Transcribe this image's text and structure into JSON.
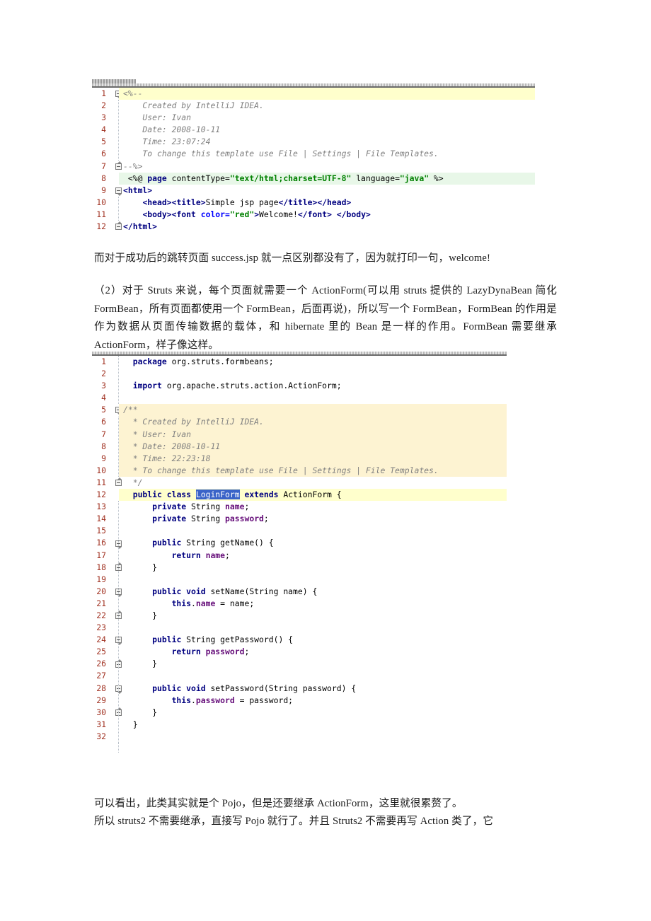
{
  "document": {
    "title": "Struts vs Struts2 FormBean notes"
  },
  "colors": {
    "keyword": "#000080",
    "string": "#008000",
    "comment": "#808080",
    "field": "#660e7a",
    "attribute": "#0000ff",
    "line_number": "#a03020",
    "selection": "#3a63c8",
    "highlight_line": "#ffffcc",
    "javadoc_bg": "#fdf3d2",
    "directive_bg": "#e8f7e8"
  },
  "code_block_jsp": {
    "name": "jsp-editor",
    "line_numbers": [
      "1",
      "2",
      "3",
      "4",
      "5",
      "6",
      "7",
      "8",
      "9",
      "10",
      "11",
      "12"
    ],
    "lines": [
      {
        "n": "1",
        "highlight": "yellow",
        "fold": "down",
        "indent_guide": false,
        "tokens": [
          {
            "t": "<%--",
            "c": "cmt"
          }
        ]
      },
      {
        "n": "2",
        "highlight": "none",
        "fold": "",
        "indent_guide": true,
        "tokens": [
          {
            "t": "    Created by IntelliJ IDEA.",
            "c": "cmt"
          }
        ]
      },
      {
        "n": "3",
        "highlight": "none",
        "fold": "",
        "indent_guide": true,
        "tokens": [
          {
            "t": "    User: Ivan",
            "c": "cmt"
          }
        ]
      },
      {
        "n": "4",
        "highlight": "none",
        "fold": "",
        "indent_guide": true,
        "tokens": [
          {
            "t": "    Date: 2008-10-11",
            "c": "cmt"
          }
        ]
      },
      {
        "n": "5",
        "highlight": "none",
        "fold": "",
        "indent_guide": true,
        "tokens": [
          {
            "t": "    Time: 23:07:24",
            "c": "cmt"
          }
        ]
      },
      {
        "n": "6",
        "highlight": "none",
        "fold": "",
        "indent_guide": true,
        "tokens": [
          {
            "t": "    To change this template use File | Settings | File Templates.",
            "c": "cmt"
          }
        ]
      },
      {
        "n": "7",
        "highlight": "none",
        "fold": "up",
        "indent_guide": false,
        "tokens": [
          {
            "t": "--%>",
            "c": "cmt"
          }
        ]
      },
      {
        "n": "8",
        "highlight": "green",
        "fold": "",
        "indent_guide": false,
        "tokens": [
          {
            "t": " <%@ ",
            "c": "plain"
          },
          {
            "t": "page",
            "c": "kw"
          },
          {
            "t": " contentType=",
            "c": "plain"
          },
          {
            "t": "\"text/html;charset=UTF-8\"",
            "c": "str"
          },
          {
            "t": " language=",
            "c": "plain"
          },
          {
            "t": "\"java\"",
            "c": "str"
          },
          {
            "t": " %>",
            "c": "plain"
          }
        ]
      },
      {
        "n": "9",
        "highlight": "none",
        "fold": "down",
        "indent_guide": false,
        "tokens": [
          {
            "t": "<html>",
            "c": "tag"
          }
        ]
      },
      {
        "n": "10",
        "highlight": "none",
        "fold": "",
        "indent_guide": true,
        "tokens": [
          {
            "t": "    ",
            "c": "plain"
          },
          {
            "t": "<head><title>",
            "c": "tag"
          },
          {
            "t": "Simple jsp page",
            "c": "plain"
          },
          {
            "t": "</title></head>",
            "c": "tag"
          }
        ]
      },
      {
        "n": "11",
        "highlight": "none",
        "fold": "",
        "indent_guide": true,
        "tokens": [
          {
            "t": "    ",
            "c": "plain"
          },
          {
            "t": "<body><font ",
            "c": "tag"
          },
          {
            "t": "color=",
            "c": "attr"
          },
          {
            "t": "\"red\"",
            "c": "str"
          },
          {
            "t": ">",
            "c": "tag"
          },
          {
            "t": "Welcome!",
            "c": "plain"
          },
          {
            "t": "</font>",
            "c": "tag"
          },
          {
            "t": " ",
            "c": "plain"
          },
          {
            "t": "</body>",
            "c": "tag"
          }
        ]
      },
      {
        "n": "12",
        "highlight": "none",
        "fold": "up",
        "indent_guide": false,
        "tokens": [
          {
            "t": "</html>",
            "c": "tag"
          }
        ]
      }
    ]
  },
  "paragraph_1": "而对于成功后的跳转页面 success.jsp 就一点区别都没有了，因为就打印一句，welcome!",
  "paragraph_2": "（2）对于 Struts 来说，每个页面就需要一个 ActionForm(可以用 struts 提供的 LazyDynaBean 简化 FormBean，所有页面都使用一个 FormBean，后面再说)，所以写一个 FormBean，FormBean 的作用是作为数据从页面传输数据的载体，和 hibernate 里的 Bean 是一样的作用。FormBean 需要继承 ActionForm，样子像这样。",
  "code_block_java": {
    "name": "java-editor",
    "line_numbers": [
      "1",
      "2",
      "3",
      "4",
      "5",
      "6",
      "7",
      "8",
      "9",
      "10",
      "11",
      "12",
      "13",
      "14",
      "15",
      "16",
      "17",
      "18",
      "19",
      "20",
      "21",
      "22",
      "23",
      "24",
      "25",
      "26",
      "27",
      "28",
      "29",
      "30",
      "31",
      "32"
    ],
    "lines": [
      {
        "n": "1",
        "highlight": "none",
        "fold": "",
        "indent_guide": true,
        "tokens": [
          {
            "t": "  ",
            "c": "plain"
          },
          {
            "t": "package",
            "c": "kw"
          },
          {
            "t": " org.struts.formbeans;",
            "c": "plain"
          }
        ]
      },
      {
        "n": "2",
        "highlight": "none",
        "fold": "",
        "indent_guide": true,
        "tokens": [
          {
            "t": "",
            "c": "plain"
          }
        ]
      },
      {
        "n": "3",
        "highlight": "none",
        "fold": "",
        "indent_guide": true,
        "tokens": [
          {
            "t": "  ",
            "c": "plain"
          },
          {
            "t": "import",
            "c": "kw"
          },
          {
            "t": " org.apache.struts.action.ActionForm;",
            "c": "plain"
          }
        ]
      },
      {
        "n": "4",
        "highlight": "none",
        "fold": "",
        "indent_guide": true,
        "tokens": [
          {
            "t": "",
            "c": "plain"
          }
        ]
      },
      {
        "n": "5",
        "highlight": "cream",
        "fold": "down",
        "indent_guide": false,
        "tokens": [
          {
            "t": "/**",
            "c": "cmt"
          }
        ]
      },
      {
        "n": "6",
        "highlight": "cream",
        "fold": "",
        "indent_guide": true,
        "tokens": [
          {
            "t": "  * Created by IntelliJ IDEA.",
            "c": "cmt"
          }
        ]
      },
      {
        "n": "7",
        "highlight": "cream",
        "fold": "",
        "indent_guide": true,
        "tokens": [
          {
            "t": "  * User: Ivan",
            "c": "cmt"
          }
        ]
      },
      {
        "n": "8",
        "highlight": "cream",
        "fold": "",
        "indent_guide": true,
        "tokens": [
          {
            "t": "  * Date: 2008-10-11",
            "c": "cmt"
          }
        ]
      },
      {
        "n": "9",
        "highlight": "cream",
        "fold": "",
        "indent_guide": true,
        "tokens": [
          {
            "t": "  * Time: 22:23:18",
            "c": "cmt"
          }
        ]
      },
      {
        "n": "10",
        "highlight": "cream",
        "fold": "",
        "indent_guide": true,
        "tokens": [
          {
            "t": "  * To change this template use File | Settings | File Templates.",
            "c": "cmt"
          }
        ]
      },
      {
        "n": "11",
        "highlight": "none",
        "fold": "up",
        "indent_guide": false,
        "tokens": [
          {
            "t": "  */",
            "c": "cmt"
          }
        ]
      },
      {
        "n": "12",
        "highlight": "selline",
        "fold": "",
        "indent_guide": false,
        "tokens": [
          {
            "t": "  ",
            "c": "plain"
          },
          {
            "t": "public class",
            "c": "kw"
          },
          {
            "t": " ",
            "c": "plain"
          },
          {
            "t": "LoginForm",
            "c": "sel"
          },
          {
            "t": " ",
            "c": "plain"
          },
          {
            "t": "extends",
            "c": "kw"
          },
          {
            "t": " ActionForm {",
            "c": "plain"
          }
        ]
      },
      {
        "n": "13",
        "highlight": "none",
        "fold": "",
        "indent_guide": true,
        "tokens": [
          {
            "t": "      ",
            "c": "plain"
          },
          {
            "t": "private",
            "c": "kw"
          },
          {
            "t": " String ",
            "c": "plain"
          },
          {
            "t": "name",
            "c": "fld"
          },
          {
            "t": ";",
            "c": "plain"
          }
        ]
      },
      {
        "n": "14",
        "highlight": "none",
        "fold": "",
        "indent_guide": true,
        "tokens": [
          {
            "t": "      ",
            "c": "plain"
          },
          {
            "t": "private",
            "c": "kw"
          },
          {
            "t": " String ",
            "c": "plain"
          },
          {
            "t": "password",
            "c": "fld"
          },
          {
            "t": ";",
            "c": "plain"
          }
        ]
      },
      {
        "n": "15",
        "highlight": "none",
        "fold": "",
        "indent_guide": true,
        "tokens": [
          {
            "t": "",
            "c": "plain"
          }
        ]
      },
      {
        "n": "16",
        "highlight": "none",
        "fold": "down",
        "indent_guide": true,
        "tokens": [
          {
            "t": "      ",
            "c": "plain"
          },
          {
            "t": "public",
            "c": "kw"
          },
          {
            "t": " String getName() {",
            "c": "plain"
          }
        ]
      },
      {
        "n": "17",
        "highlight": "none",
        "fold": "",
        "indent_guide": true,
        "tokens": [
          {
            "t": "          ",
            "c": "plain"
          },
          {
            "t": "return",
            "c": "kw"
          },
          {
            "t": " ",
            "c": "plain"
          },
          {
            "t": "name",
            "c": "fld"
          },
          {
            "t": ";",
            "c": "plain"
          }
        ]
      },
      {
        "n": "18",
        "highlight": "none",
        "fold": "up",
        "indent_guide": true,
        "tokens": [
          {
            "t": "      }",
            "c": "plain"
          }
        ]
      },
      {
        "n": "19",
        "highlight": "none",
        "fold": "",
        "indent_guide": true,
        "tokens": [
          {
            "t": "",
            "c": "plain"
          }
        ]
      },
      {
        "n": "20",
        "highlight": "none",
        "fold": "down",
        "indent_guide": true,
        "tokens": [
          {
            "t": "      ",
            "c": "plain"
          },
          {
            "t": "public void",
            "c": "kw"
          },
          {
            "t": " setName(String name) {",
            "c": "plain"
          }
        ]
      },
      {
        "n": "21",
        "highlight": "none",
        "fold": "",
        "indent_guide": true,
        "tokens": [
          {
            "t": "          ",
            "c": "plain"
          },
          {
            "t": "this",
            "c": "kw"
          },
          {
            "t": ".",
            "c": "plain"
          },
          {
            "t": "name",
            "c": "fld"
          },
          {
            "t": " = name;",
            "c": "plain"
          }
        ]
      },
      {
        "n": "22",
        "highlight": "none",
        "fold": "up",
        "indent_guide": true,
        "tokens": [
          {
            "t": "      }",
            "c": "plain"
          }
        ]
      },
      {
        "n": "23",
        "highlight": "none",
        "fold": "",
        "indent_guide": true,
        "tokens": [
          {
            "t": "",
            "c": "plain"
          }
        ]
      },
      {
        "n": "24",
        "highlight": "none",
        "fold": "down",
        "indent_guide": true,
        "tokens": [
          {
            "t": "      ",
            "c": "plain"
          },
          {
            "t": "public",
            "c": "kw"
          },
          {
            "t": " String getPassword() {",
            "c": "plain"
          }
        ]
      },
      {
        "n": "25",
        "highlight": "none",
        "fold": "",
        "indent_guide": true,
        "tokens": [
          {
            "t": "          ",
            "c": "plain"
          },
          {
            "t": "return",
            "c": "kw"
          },
          {
            "t": " ",
            "c": "plain"
          },
          {
            "t": "password",
            "c": "fld"
          },
          {
            "t": ";",
            "c": "plain"
          }
        ]
      },
      {
        "n": "26",
        "highlight": "none",
        "fold": "up",
        "indent_guide": true,
        "tokens": [
          {
            "t": "      }",
            "c": "plain"
          }
        ]
      },
      {
        "n": "27",
        "highlight": "none",
        "fold": "",
        "indent_guide": true,
        "tokens": [
          {
            "t": "",
            "c": "plain"
          }
        ]
      },
      {
        "n": "28",
        "highlight": "none",
        "fold": "down",
        "indent_guide": true,
        "tokens": [
          {
            "t": "      ",
            "c": "plain"
          },
          {
            "t": "public void",
            "c": "kw"
          },
          {
            "t": " setPassword(String password) {",
            "c": "plain"
          }
        ]
      },
      {
        "n": "29",
        "highlight": "none",
        "fold": "",
        "indent_guide": true,
        "tokens": [
          {
            "t": "          ",
            "c": "plain"
          },
          {
            "t": "this",
            "c": "kw"
          },
          {
            "t": ".",
            "c": "plain"
          },
          {
            "t": "password",
            "c": "fld"
          },
          {
            "t": " = password;",
            "c": "plain"
          }
        ]
      },
      {
        "n": "30",
        "highlight": "none",
        "fold": "up",
        "indent_guide": true,
        "tokens": [
          {
            "t": "      }",
            "c": "plain"
          }
        ]
      },
      {
        "n": "31",
        "highlight": "none",
        "fold": "",
        "indent_guide": true,
        "tokens": [
          {
            "t": "  }",
            "c": "plain"
          }
        ]
      },
      {
        "n": "32",
        "highlight": "none",
        "fold": "",
        "indent_guide": true,
        "tokens": [
          {
            "t": "",
            "c": "plain"
          }
        ]
      }
    ]
  },
  "paragraph_3": "可以看出，此类其实就是个 Pojo，但是还要继承 ActionForm，这里就很累赘了。",
  "paragraph_4": "所以 struts2 不需要继承，直接写 Pojo 就行了。并且 Struts2 不需要再写 Action 类了，它"
}
